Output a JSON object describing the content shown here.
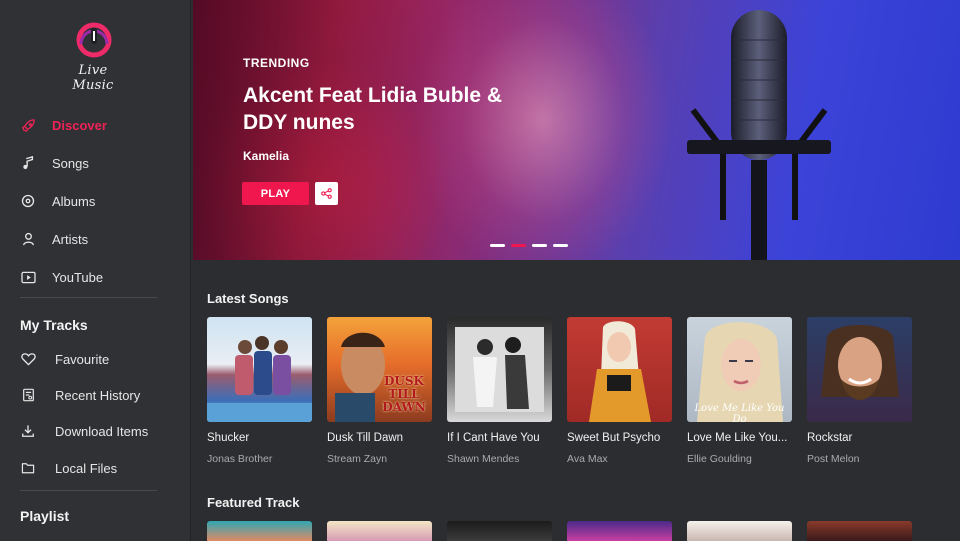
{
  "app": {
    "logo_text": "Live Music"
  },
  "sidebar": {
    "nav": [
      {
        "label": "Discover",
        "icon": "rocket-icon",
        "active": true
      },
      {
        "label": "Songs",
        "icon": "music-note-icon"
      },
      {
        "label": "Albums",
        "icon": "disc-icon"
      },
      {
        "label": "Artists",
        "icon": "user-icon"
      },
      {
        "label": "YouTube",
        "icon": "video-icon"
      }
    ],
    "my_tracks_title": "My Tracks",
    "my_tracks": [
      {
        "label": "Favourite",
        "icon": "heart-icon"
      },
      {
        "label": "Recent History",
        "icon": "history-icon"
      },
      {
        "label": "Download Items",
        "icon": "download-icon"
      },
      {
        "label": "Local Files",
        "icon": "folder-icon"
      }
    ],
    "playlist_title": "Playlist"
  },
  "hero": {
    "eyebrow": "TRENDING",
    "title": "Akcent Feat Lidia Buble & DDY nunes",
    "artist": "Kamelia",
    "play_label": "PLAY",
    "slides": 4,
    "active_slide": 2
  },
  "latest": {
    "title": "Latest Songs",
    "items": [
      {
        "title": "Shucker",
        "artist": "Jonas Brother"
      },
      {
        "title": "Dusk Till Dawn",
        "artist": "Stream Zayn",
        "art_text": "DUSK TILL DAWN"
      },
      {
        "title": "If I Cant Have You",
        "artist": "Shawn Mendes"
      },
      {
        "title": "Sweet But Psycho",
        "artist": "Ava Max"
      },
      {
        "title": "Love Me Like You...",
        "artist": "Ellie Goulding",
        "art_text": "Love Me Like You Do"
      },
      {
        "title": "Rockstar",
        "artist": "Post Melon"
      }
    ]
  },
  "featured": {
    "title": "Featured Track"
  },
  "colors": {
    "accent": "#f0174f",
    "sidebar": "#2f3134",
    "background": "#2b2d30"
  }
}
